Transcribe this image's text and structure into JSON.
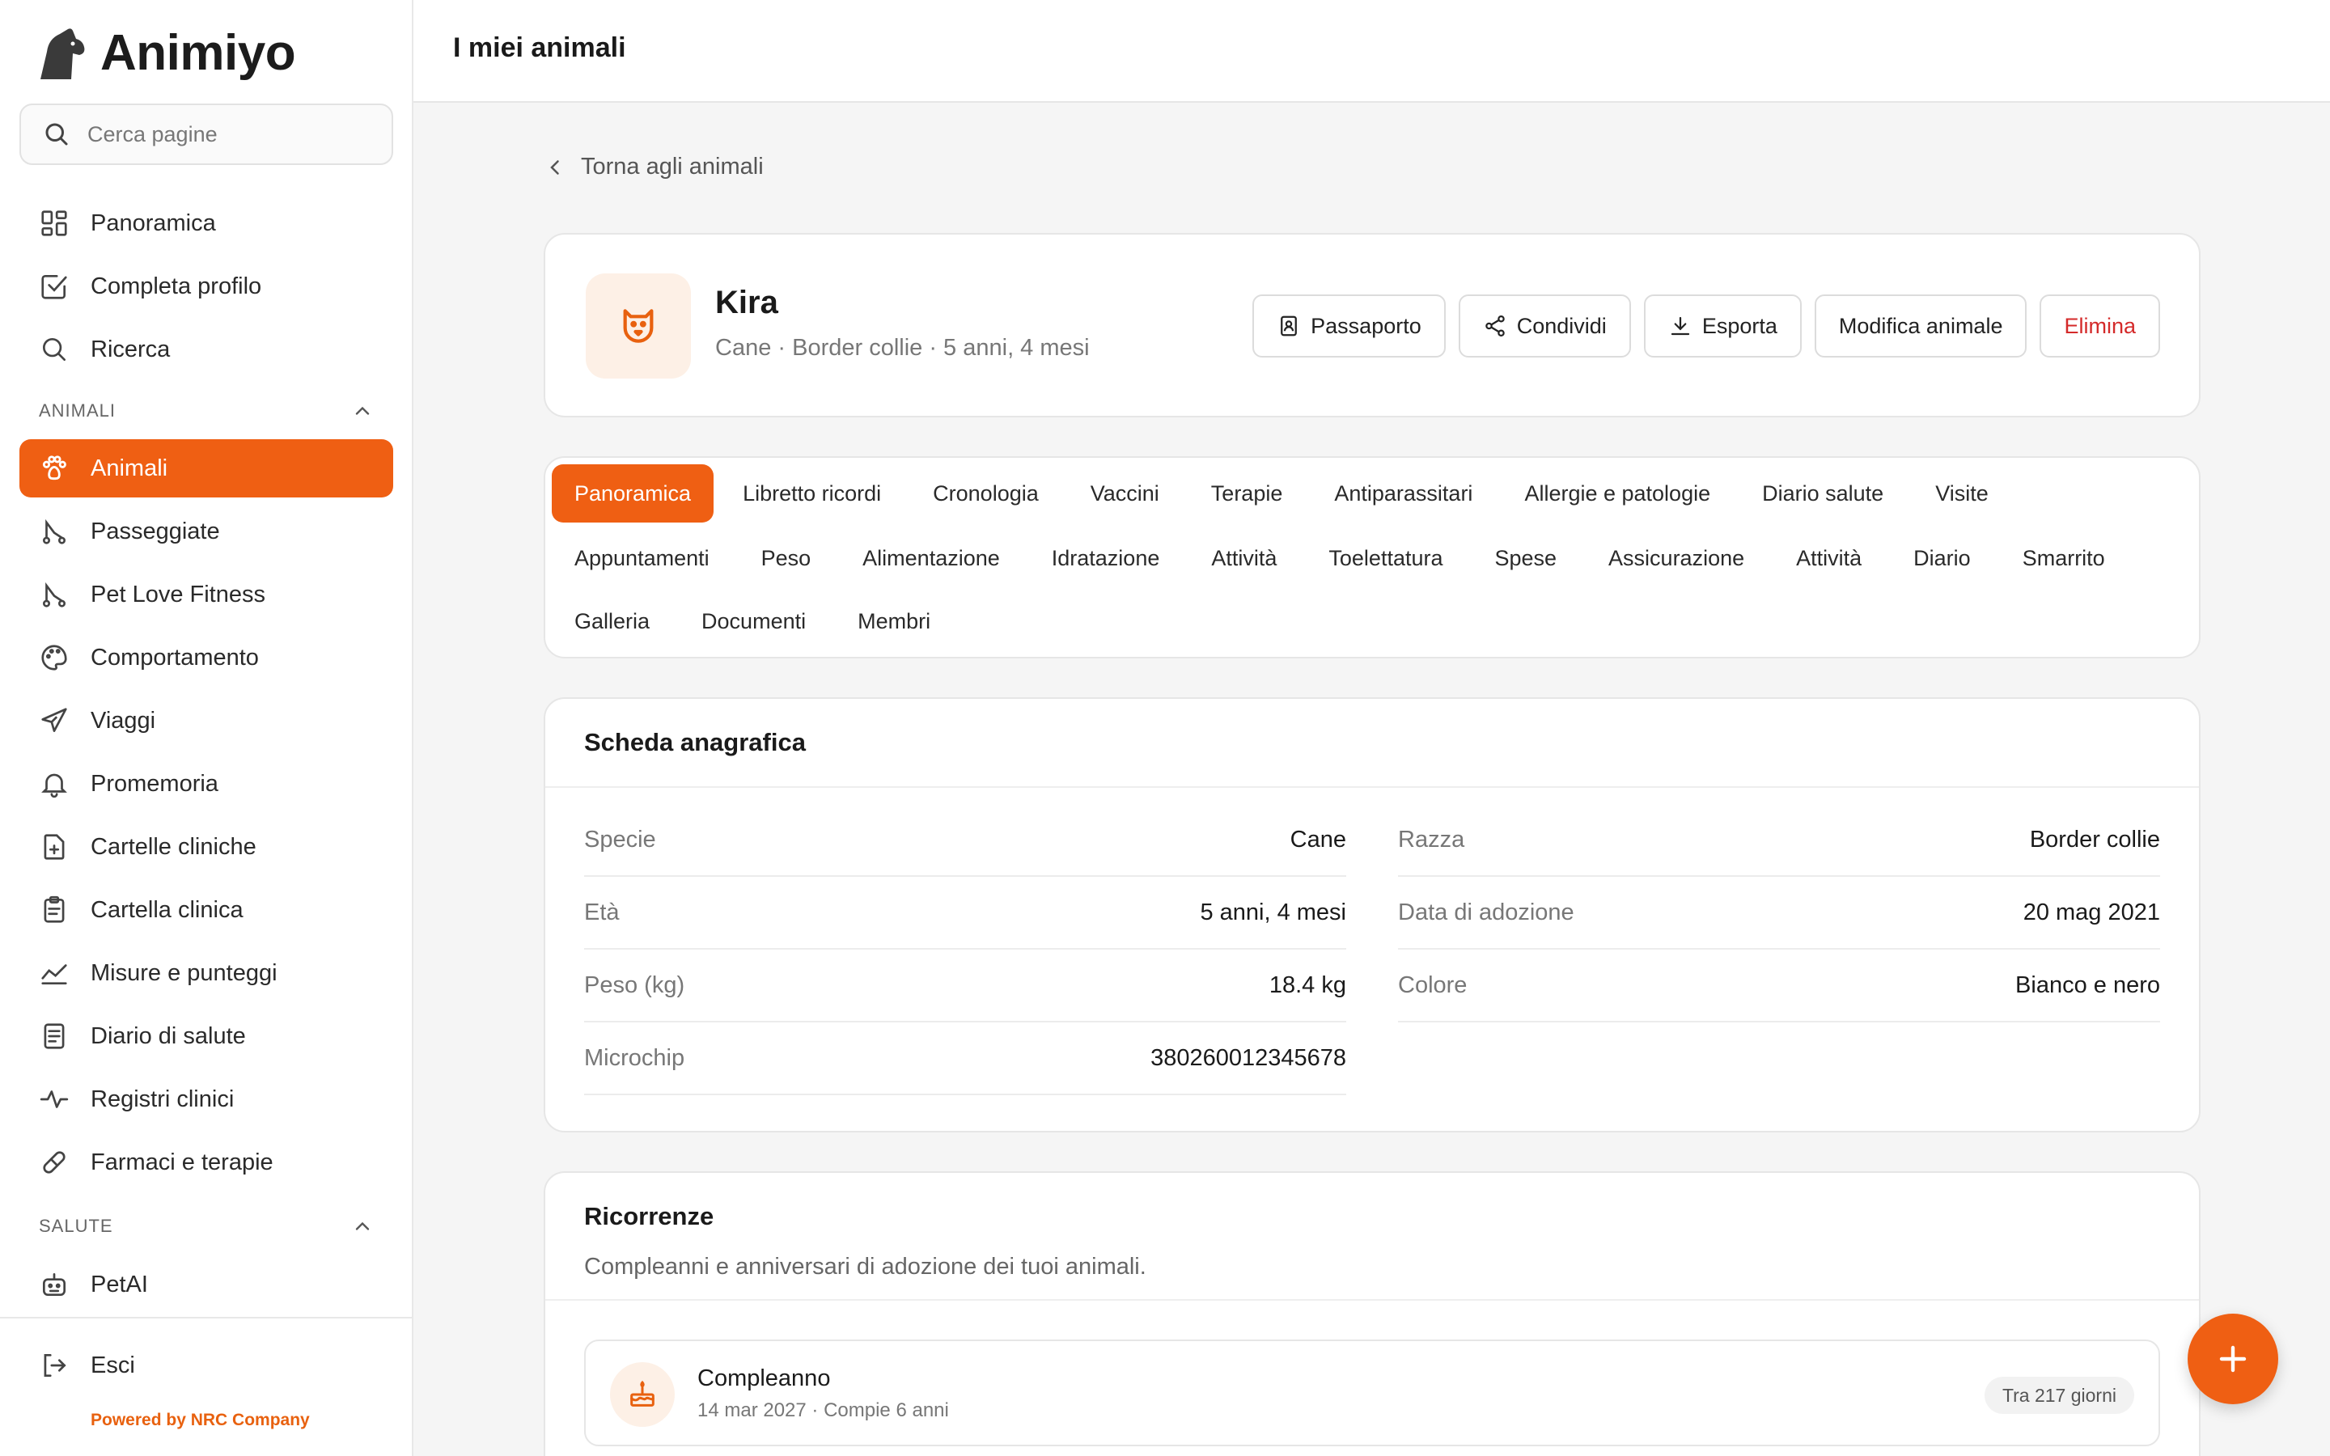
{
  "brand": {
    "name": "Animiyo",
    "icon": "dog-logo-icon"
  },
  "search": {
    "placeholder": "Cerca pagine"
  },
  "nav": {
    "top": [
      {
        "label": "Panoramica",
        "icon": "grid-icon"
      },
      {
        "label": "Completa profilo",
        "icon": "checkbox-icon"
      },
      {
        "label": "Ricerca",
        "icon": "search-icon"
      }
    ],
    "section_animals": "ANIMALI",
    "animals": [
      {
        "label": "Animali",
        "icon": "paw-icon",
        "active": true
      },
      {
        "label": "Passeggiate",
        "icon": "route-icon"
      },
      {
        "label": "Pet Love Fitness",
        "icon": "route-icon"
      },
      {
        "label": "Comportamento",
        "icon": "palette-icon"
      },
      {
        "label": "Viaggi",
        "icon": "plane-icon"
      },
      {
        "label": "Promemoria",
        "icon": "bell-icon"
      },
      {
        "label": "Cartelle cliniche",
        "icon": "file-plus-icon"
      },
      {
        "label": "Cartella clinica",
        "icon": "clipboard-icon"
      },
      {
        "label": "Misure e punteggi",
        "icon": "chart-line-icon"
      },
      {
        "label": "Diario di salute",
        "icon": "document-icon"
      },
      {
        "label": "Registri clinici",
        "icon": "pulse-icon"
      },
      {
        "label": "Farmaci e terapie",
        "icon": "pill-icon"
      }
    ],
    "section_health": "SALUTE",
    "health": [
      {
        "label": "PetAI",
        "icon": "robot-icon"
      }
    ],
    "logout": "Esci",
    "powered": "Powered by NRC Company"
  },
  "header": {
    "title": "I miei animali"
  },
  "back": {
    "label": "Torna agli animali"
  },
  "pet": {
    "name": "Kira",
    "subtitle": "Cane · Border collie · 5 anni, 4 mesi",
    "actions": {
      "passport": "Passaporto",
      "share": "Condividi",
      "export": "Esporta",
      "edit": "Modifica animale",
      "delete": "Elimina"
    }
  },
  "tabs": [
    [
      "Panoramica",
      "Libretto ricordi",
      "Cronologia",
      "Vaccini",
      "Terapie",
      "Antiparassitari",
      "Allergie e patologie",
      "Diario salute",
      "Visite"
    ],
    [
      "Appuntamenti",
      "Peso",
      "Alimentazione",
      "Idratazione",
      "Attività",
      "Toelettatura",
      "Spese",
      "Assicurazione",
      "Attività",
      "Diario",
      "Smarrito"
    ],
    [
      "Galleria",
      "Documenti",
      "Membri"
    ]
  ],
  "profile": {
    "title": "Scheda anagrafica",
    "fields": [
      {
        "k": "Specie",
        "v": "Cane"
      },
      {
        "k": "Razza",
        "v": "Border collie"
      },
      {
        "k": "Età",
        "v": "5 anni, 4 mesi"
      },
      {
        "k": "Data di adozione",
        "v": "20 mag 2021"
      },
      {
        "k": "Peso (kg)",
        "v": "18.4 kg"
      },
      {
        "k": "Colore",
        "v": "Bianco e nero"
      },
      {
        "k": "Microchip",
        "v": "380260012345678"
      }
    ]
  },
  "recurrences": {
    "title": "Ricorrenze",
    "subtitle": "Compleanni e anniversari di adozione dei tuoi animali.",
    "items": [
      {
        "title": "Compleanno",
        "detail": "14 mar 2027 · Compie 6 anni",
        "badge": "Tra 217 giorni",
        "icon": "cake-icon"
      }
    ]
  },
  "colors": {
    "accent": "#ef5f13",
    "danger": "#d42a2a"
  }
}
